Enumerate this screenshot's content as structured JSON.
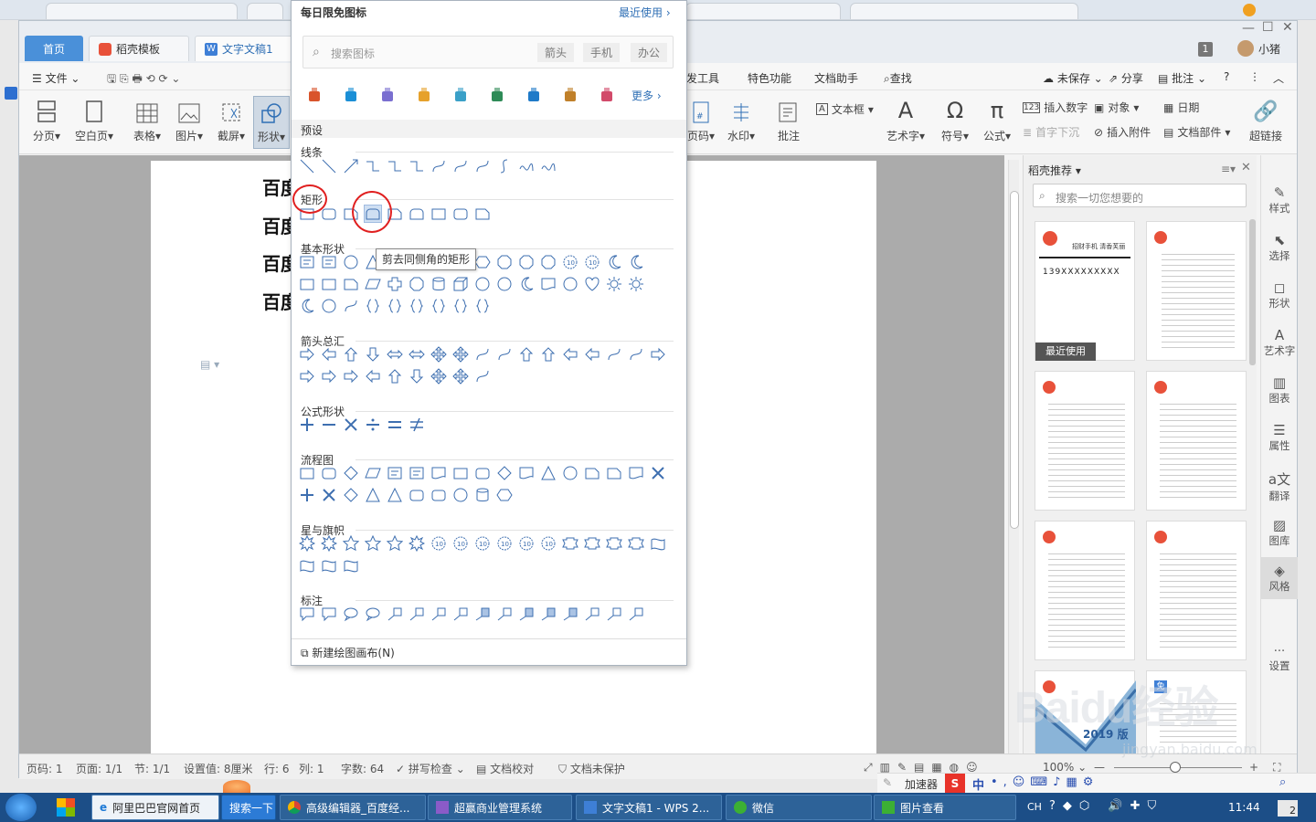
{
  "browser_tabs": [],
  "wps": {
    "tabs": {
      "home": "首页",
      "template": "稻壳模板",
      "doc": "文字文稿1"
    },
    "window_badge": "1",
    "user": "小猪",
    "menu": {
      "file": "文件",
      "dev": "发工具",
      "special": "特色功能",
      "assistant": "文档助手",
      "find": "查找",
      "unsaved": "未保存",
      "share": "分享",
      "comment": "批注"
    },
    "ribbon": {
      "pagebreak": "分页",
      "blank": "空白页",
      "table": "表格",
      "picture": "图片",
      "screenshot": "截屏",
      "shape": "形状",
      "pageno": "页码",
      "watermark": "水印",
      "comment": "批注",
      "textbox": "文本框",
      "art": "艺术字",
      "symbol": "符号",
      "formula": "公式",
      "insert_num": "插入数字",
      "object": "对象",
      "date": "日期",
      "first_sink": "首字下沉",
      "attach": "插入附件",
      "parts": "文档部件",
      "hyperlink": "超链接"
    },
    "doc_lines": [
      "百度",
      "百度",
      "百度",
      "百度"
    ],
    "panel": {
      "title": "稻壳推荐",
      "search_placeholder": "搜索一切您想要的",
      "recent_label": "最近使用",
      "t1_title": "招财手机  清香芙丽",
      "t1_phone": "139XXXXXXXXX",
      "year": "2019 版",
      "free_badge": "免"
    },
    "right_tools": [
      "样式",
      "选择",
      "形状",
      "艺术字",
      "图表",
      "属性",
      "翻译",
      "图库",
      "风格",
      "设置"
    ],
    "status": {
      "page": "页码: 1",
      "pages": "页面: 1/1",
      "section": "节: 1/1",
      "setval": "设置值: 8厘米",
      "row": "行: 6",
      "col": "列: 1",
      "words": "字数: 64",
      "spell": "拼写检查",
      "proof": "文档校对",
      "protect": "文档未保护",
      "zoom": "100%"
    }
  },
  "dropdown": {
    "header": "每日限免图标",
    "recent": "最近使用",
    "search_placeholder": "搜索图标",
    "tags": [
      "箭头",
      "手机",
      "办公"
    ],
    "more": "更多",
    "preset": "预设",
    "sections": {
      "lines": "线条",
      "rect": "矩形",
      "basic": "基本形状",
      "arrows": "箭头总汇",
      "formula": "公式形状",
      "flow": "流程图",
      "stars": "星与旗帜",
      "callouts": "标注"
    },
    "tooltip": "剪去同侧角的矩形",
    "new_canvas": "新建绘图画布(N)"
  },
  "ime": {
    "accel": "加速器",
    "ch": "中"
  },
  "taskbar": {
    "items": [
      "阿里巴巴官网首页",
      "搜索一下",
      "高级编辑器_百度经...",
      "超赢商业管理系统",
      "文字文稿1 - WPS 2...",
      "微信",
      "图片查看"
    ],
    "lang": "CH",
    "time": "11:44",
    "badge": "2"
  },
  "watermark": {
    "text": "Baidu经验",
    "url": "jingyan.baidu.com"
  }
}
